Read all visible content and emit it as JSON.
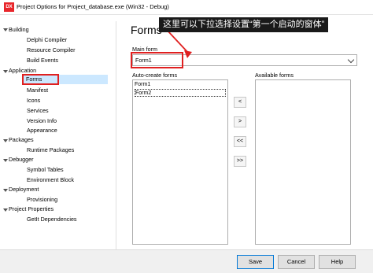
{
  "window": {
    "icon_text": "DX",
    "title": "Project Options for Project_database.exe  (Win32 - Debug)"
  },
  "tree": [
    {
      "label": "Building",
      "level": 0,
      "expanded": true
    },
    {
      "label": "Delphi Compiler",
      "level": 1
    },
    {
      "label": "Resource Compiler",
      "level": 1
    },
    {
      "label": "Build Events",
      "level": 1
    },
    {
      "label": "Application",
      "level": 0,
      "expanded": true
    },
    {
      "label": "Forms",
      "level": 1,
      "selected": true
    },
    {
      "label": "Manifest",
      "level": 1
    },
    {
      "label": "Icons",
      "level": 1
    },
    {
      "label": "Services",
      "level": 1
    },
    {
      "label": "Version Info",
      "level": 1
    },
    {
      "label": "Appearance",
      "level": 1
    },
    {
      "label": "Packages",
      "level": 0,
      "expanded": true
    },
    {
      "label": "Runtime Packages",
      "level": 1
    },
    {
      "label": "Debugger",
      "level": 0,
      "expanded": true
    },
    {
      "label": "Symbol Tables",
      "level": 1
    },
    {
      "label": "Environment Block",
      "level": 1
    },
    {
      "label": "Deployment",
      "level": 0,
      "expanded": true
    },
    {
      "label": "Provisioning",
      "level": 1
    },
    {
      "label": "Project Properties",
      "level": 0,
      "expanded": true
    },
    {
      "label": "GetIt Dependencies",
      "level": 1
    }
  ],
  "content": {
    "title": "Forms",
    "main_form_label": "Main form",
    "main_form_value": "Form1",
    "auto_create_label": "Auto-create forms",
    "auto_create_items": [
      "Form1",
      "Form2"
    ],
    "available_label": "Available forms",
    "available_items": [],
    "move_buttons": [
      ">",
      "<",
      ">>",
      "<<"
    ]
  },
  "buttons": {
    "save": "Save",
    "cancel": "Cancel",
    "help": "Help"
  },
  "annotation": {
    "text": "这里可以下拉选择设置“第一个启动的窗体”",
    "color": "#e02020"
  }
}
